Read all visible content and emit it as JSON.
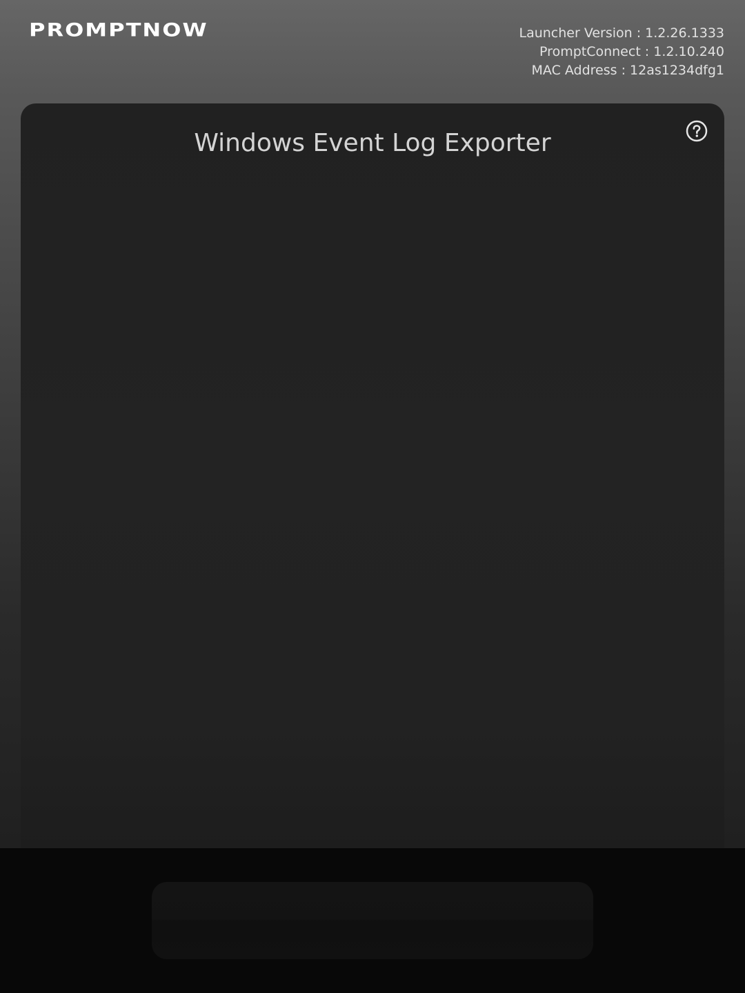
{
  "header": {
    "logo_text": "PROMPTNOW",
    "launcher_version": "Launcher Version : 1.2.26.1333",
    "prompt_connect": "PromptConnect : 1.2.10.240",
    "mac_address": "MAC Address : 12as1234dfg1"
  },
  "panel": {
    "title": "Windows Event Log Exporter",
    "help_icon": "help-circle-icon"
  },
  "colors": {
    "header_bg": "#666666",
    "panel_bg": "#222222",
    "footer_bg": "#080808",
    "text_light": "#e2e2e2"
  }
}
